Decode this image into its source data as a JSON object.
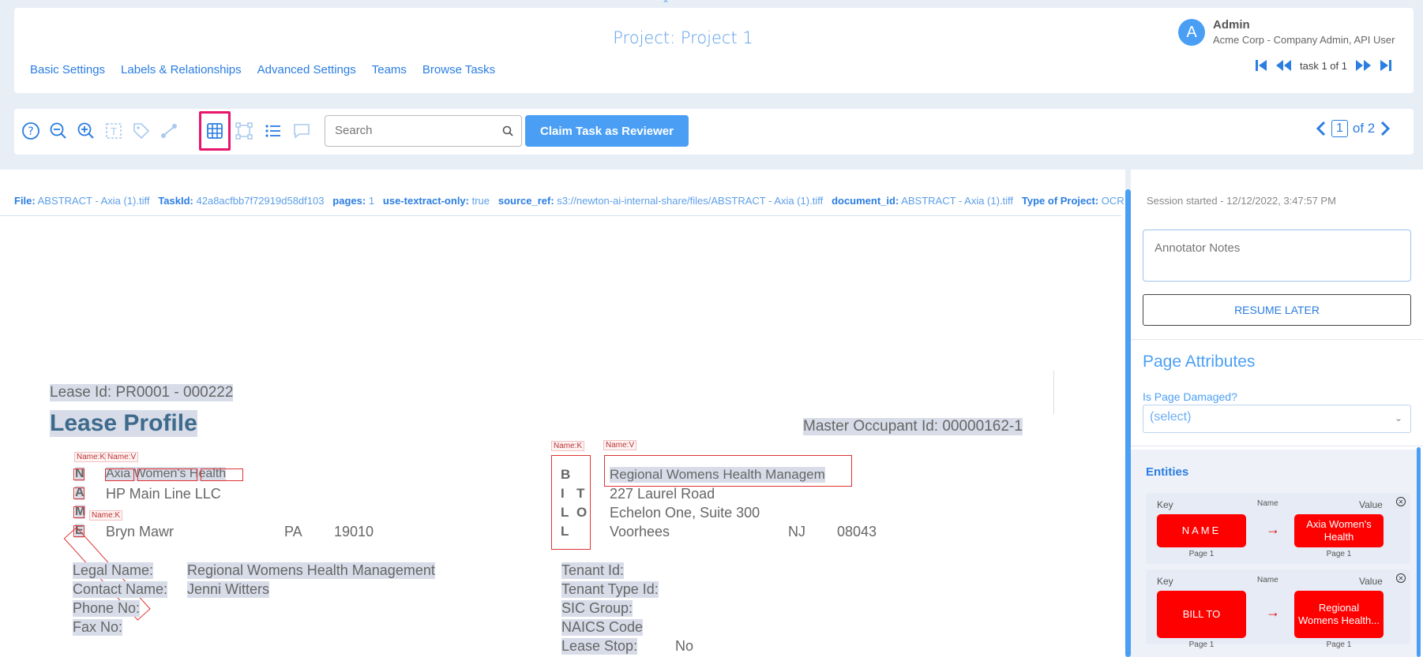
{
  "header": {
    "project_title": "Project: Project 1",
    "user": {
      "initial": "A",
      "name": "Admin",
      "role": "Acme Corp - Company Admin, API User"
    },
    "nav_links": [
      "Basic Settings",
      "Labels & Relationships",
      "Advanced Settings",
      "Teams",
      "Browse Tasks"
    ],
    "task_counter": "task 1 of 1"
  },
  "toolbar": {
    "icons": [
      "help-icon",
      "zoom-out-icon",
      "zoom-in-icon",
      "text-select-icon",
      "tag-icon",
      "relation-icon",
      "table-icon",
      "bounding-box-icon",
      "list-icon",
      "comment-icon"
    ],
    "search_placeholder": "Search",
    "claim_button": "Claim Task as Reviewer",
    "page_current": "1",
    "page_total": "of 2"
  },
  "meta": [
    {
      "key": "File:",
      "value": "ABSTRACT - Axia (1).tiff"
    },
    {
      "key": "TaskId:",
      "value": "42a8acfbb7f72919d58df103"
    },
    {
      "key": "pages:",
      "value": "1"
    },
    {
      "key": "use-textract-only:",
      "value": "true"
    },
    {
      "key": "source_ref:",
      "value": "s3://newton-ai-internal-share/files/ABSTRACT - Axia (1).tiff"
    },
    {
      "key": "document_id:",
      "value": "ABSTRACT - Axia (1).tiff"
    },
    {
      "key": "Type of Project:",
      "value": "OCR"
    }
  ],
  "document": {
    "lease_id": "Lease Id: PR0001 - 000222",
    "title": "Lease Profile",
    "master_occupant": "Master Occupant Id: 00000162-1",
    "name_block": {
      "letters": [
        "N",
        "A",
        "M",
        "E"
      ],
      "lines": [
        "Axia Women's Health",
        "HP Main Line LLC",
        "",
        "Bryn Mawr"
      ],
      "state": "PA",
      "zip": "19010"
    },
    "bill_block": {
      "letters_col1": [
        "B",
        "I",
        "L",
        "L"
      ],
      "letters_col2": [
        "",
        "T",
        "O",
        ""
      ],
      "lines": [
        "Regional Womens Health Managem",
        "227 Laurel Road",
        "Echelon One, Suite 300",
        "Voorhees"
      ],
      "state": "NJ",
      "zip": "08043"
    },
    "left_fields": [
      {
        "label": "Legal Name:",
        "value": "Regional Womens Health Management"
      },
      {
        "label": "Contact Name:",
        "value": "Jenni  Witters"
      },
      {
        "label": "Phone No:",
        "value": ""
      },
      {
        "label": "Fax No:",
        "value": ""
      }
    ],
    "right_fields": [
      {
        "label": "Tenant Id:",
        "value": ""
      },
      {
        "label": "Tenant Type Id:",
        "value": ""
      },
      {
        "label": "SIC Group:",
        "value": ""
      },
      {
        "label": "NAICS Code",
        "value": ""
      },
      {
        "label": "Lease Stop:",
        "value": "No"
      }
    ],
    "tags": {
      "name_key": "Name:K",
      "name_value": "Name:V"
    }
  },
  "sidebar": {
    "session": "Session started - 12/12/2022, 3:47:57 PM",
    "notes_placeholder": "Annotator Notes",
    "resume_button": "RESUME LATER",
    "page_attributes_title": "Page Attributes",
    "damaged_label": "Is Page Damaged?",
    "damaged_value": "(select)",
    "entities_title": "Entities",
    "entity_headers": {
      "key": "Key",
      "name": "Name",
      "value": "Value"
    },
    "entities": [
      {
        "key": "NAME",
        "value": "Axia Women's Health",
        "key_page": "Page 1",
        "value_page": "Page 1"
      },
      {
        "key": "BILL TO",
        "value": "Regional Womens Health...",
        "key_page": "Page 1",
        "value_page": "Page 1"
      }
    ]
  }
}
